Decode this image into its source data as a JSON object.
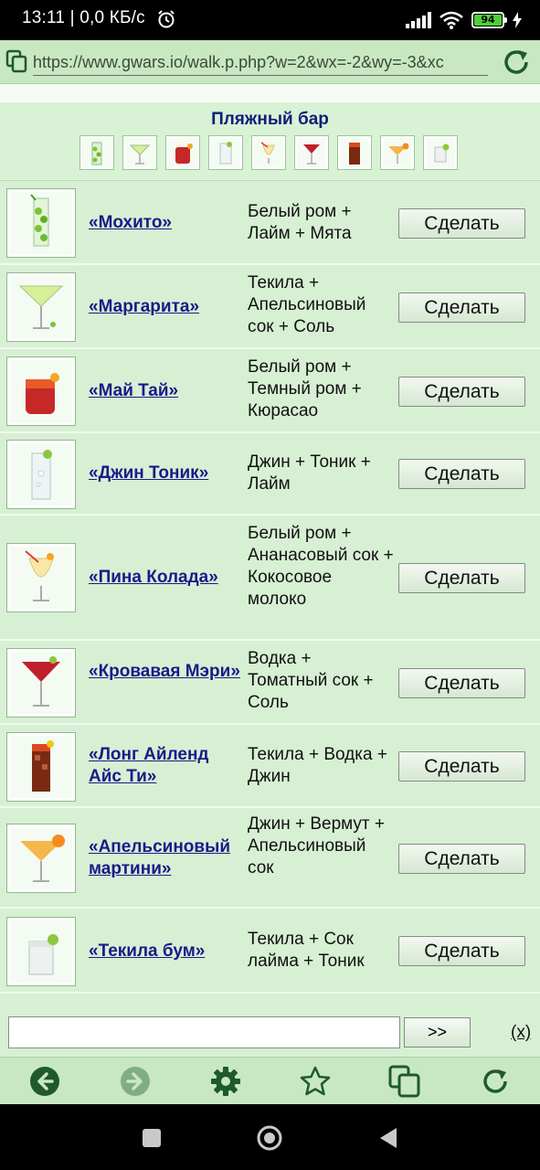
{
  "status": {
    "time_text": "13:11 | 0,0 КБ/с",
    "battery_level": "94"
  },
  "browser": {
    "url": "https://www.gwars.io/walk.p.php?w=2&wx=-2&wy=-3&xc"
  },
  "bar": {
    "title": "Пляжный бар"
  },
  "cocktails": [
    {
      "name": "«Мохито»",
      "ingredients": "Белый ром + Лайм + Мята",
      "action": "Сделать"
    },
    {
      "name": "«Маргарита»",
      "ingredients": "Текила + Апельсиновый сок + Соль",
      "action": "Сделать"
    },
    {
      "name": "«Май Тай»",
      "ingredients": "Белый ром + Темный ром + Кюрасао",
      "action": "Сделать"
    },
    {
      "name": "«Джин Тоник»",
      "ingredients": "Джин + Тоник + Лайм",
      "action": "Сделать"
    },
    {
      "name": "«Пина Колада»",
      "ingredients": "Белый ром + Ананасовый сок + Кокосовое молоко",
      "action": "Сделать"
    },
    {
      "name": "«Кровавая Мэри»",
      "ingredients": "Водка + Томатный сок + Соль",
      "action": "Сделать"
    },
    {
      "name": "«Лонг Айленд Айс Ти»",
      "ingredients": "Текила + Водка + Джин",
      "action": "Сделать"
    },
    {
      "name": "«Апельсиновый мартини»",
      "ingredients": "Джин + Вермут + Апельсиновый сок",
      "action": "Сделать"
    },
    {
      "name": "«Текила бум»",
      "ingredients": "Текила + Сок лайма + Тоник",
      "action": "Сделать"
    }
  ],
  "chat": {
    "input_value": "",
    "send_label": ">>",
    "clear_label": "(x)"
  },
  "toolbar": {
    "icons": [
      "back-icon",
      "forward-icon",
      "settings-icon",
      "bookmark-star-icon",
      "tabs-icon",
      "reload-icon"
    ]
  },
  "colors": {
    "page_bg": "#d7f0d3",
    "link": "#1a1a8a",
    "title": "#0d1f7a",
    "browser_chrome": "#c8e8c2",
    "icon_green": "#1f5a2a"
  }
}
